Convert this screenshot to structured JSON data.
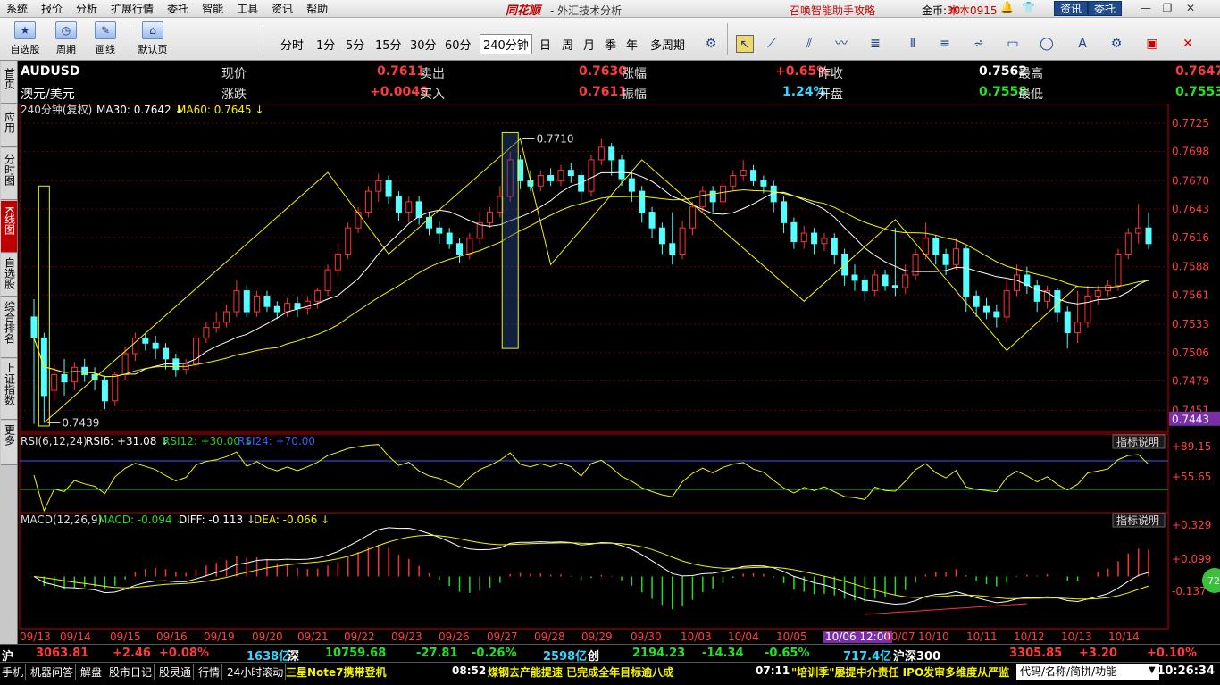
{
  "menu": {
    "items": [
      "系统",
      "报价",
      "分析",
      "扩展行情",
      "委托",
      "智能",
      "工具",
      "资讯",
      "帮助"
    ],
    "brand": "同花顺",
    "app_title": "- 外汇技术分析",
    "promo": "召唤智能助手攻略",
    "gold_label": "金币:",
    "gold_value": "30",
    "version": "本本0915",
    "news_btn": "资讯",
    "trade_btn": "委托"
  },
  "toolbar": {
    "big_buttons": [
      "自选股",
      "周期",
      "画线",
      "默认页"
    ],
    "periods": [
      "分时",
      "1分",
      "5分",
      "15分",
      "30分",
      "60分",
      "240分钟",
      "日",
      "周",
      "月",
      "季",
      "年",
      "多周期"
    ],
    "active_period": "240分钟"
  },
  "sidetabs": [
    "首页",
    "应用",
    "分时图",
    "K线图",
    "自选股",
    "综合排名",
    "上证指数",
    "更多"
  ],
  "sidetabs_active": "K线图",
  "quote": {
    "symbol": "AUDUSD",
    "name": "澳元/美元",
    "price_label": "现价",
    "price": "0.7611",
    "sell_label": "卖出",
    "sell": "0.7630",
    "chg_pct_label": "涨幅",
    "chg_pct": "+0.65%",
    "prev_close_label": "昨收",
    "prev_close": "0.7562",
    "high_label": "最高",
    "high": "0.7647",
    "chg_label": "涨跌",
    "chg": "+0.0049",
    "buy_label": "买入",
    "buy": "0.7611",
    "amp_label": "振幅",
    "amp": "1.24%",
    "open_label": "开盘",
    "open": "0.7558",
    "low_label": "最低",
    "low": "0.7553"
  },
  "main_chart": {
    "period_label": "240分钟(复权)",
    "ma30_label": "MA30: 0.7642",
    "ma60_label": "MA60: 0.7645",
    "y_ticks": [
      "0.7725",
      "0.7698",
      "0.7670",
      "0.7643",
      "0.7616",
      "0.7588",
      "0.7561",
      "0.7533",
      "0.7506",
      "0.7479",
      "0.7451"
    ],
    "current_price_tag": "0.7443",
    "high_annotation": "0.7710",
    "low_annotation": "0.7439"
  },
  "rsi": {
    "label": "RSI(6,12,24)",
    "rsi6": "RSI6: +31.08",
    "rsi12": "RSI12: +30.00",
    "rsi24": "RSI24: +70.00",
    "y_ticks": [
      "+89.15",
      "+55.65"
    ],
    "help_btn": "指标说明"
  },
  "macd": {
    "label": "MACD(12,26,9)",
    "macd_val": "MACD: -0.094",
    "diff_val": "DIFF: -0.113",
    "dea_val": "DEA: -0.066",
    "y_ticks": [
      "+0.329",
      "+0.099",
      "-0.137"
    ],
    "help_btn": "指标说明",
    "badge": "72"
  },
  "date_axis": [
    "09/13",
    "09/14",
    "09/15",
    "09/16",
    "09/19",
    "09/20",
    "09/21",
    "09/22",
    "09/23",
    "09/26",
    "09/27",
    "09/28",
    "09/29",
    "09/30",
    "10/03",
    "10/04",
    "10/05",
    "10/06 12:00",
    "10/07",
    "10/10",
    "10/11",
    "10/12",
    "10/13",
    "10/14"
  ],
  "date_axis_highlight": "10/06 12:00",
  "stockbar": {
    "sh_label": "沪",
    "sh_index": "3063.81",
    "sh_chg": "+2.46",
    "sh_pct": "+0.08%",
    "sh_amount": "1638亿",
    "sz_label": "深",
    "sz_index": "10759.68",
    "sz_chg": "-27.81",
    "sz_pct": "-0.26%",
    "sz_amount": "2598亿",
    "cy_label": "创",
    "cy_index": "2194.23",
    "cy_chg": "-14.34",
    "cy_pct": "-0.65%",
    "cy_amount": "717.4亿",
    "hs_label": "沪深300",
    "hs_index": "3305.85",
    "hs_chg": "+3.20",
    "hs_pct": "+0.10%"
  },
  "statusbar": {
    "items": [
      "手机",
      "机器问答",
      "解盘",
      "股市日记",
      "股灵通",
      "行情",
      "24小时滚动"
    ],
    "news1": "三星Note7携带登机",
    "news2_time": "08:52",
    "news2": "煤钢去产能提速  已完成全年目标逾八成",
    "news3_time": "07:11",
    "news3": "\"培训季\"屡提中介责任 IPO发审多维度从严监",
    "search_placeholder": "代码/名称/简拼/功能",
    "clock": "10:26:34"
  },
  "chart_data": {
    "type": "candlestick",
    "instrument": "AUDUSD",
    "period": "240分钟",
    "ylim": [
      0.743,
      0.773
    ],
    "y_ticks": [
      0.7725,
      0.7698,
      0.767,
      0.7643,
      0.7616,
      0.7588,
      0.7561,
      0.7533,
      0.7506,
      0.7479,
      0.7451
    ],
    "candles": [
      [
        0.754,
        0.752,
        0.7557,
        0.7438
      ],
      [
        0.752,
        0.7465,
        0.7525,
        0.744
      ],
      [
        0.747,
        0.7485,
        0.7495,
        0.746
      ],
      [
        0.7485,
        0.7478,
        0.75,
        0.7465
      ],
      [
        0.7478,
        0.7492,
        0.7497,
        0.747
      ],
      [
        0.7492,
        0.7485,
        0.75,
        0.7478
      ],
      [
        0.7485,
        0.748,
        0.7492,
        0.747
      ],
      [
        0.748,
        0.746,
        0.7484,
        0.7452
      ],
      [
        0.746,
        0.7485,
        0.7488,
        0.7455
      ],
      [
        0.7485,
        0.7505,
        0.7512,
        0.748
      ],
      [
        0.7505,
        0.752,
        0.7525,
        0.7498
      ],
      [
        0.752,
        0.7515,
        0.7525,
        0.7508
      ],
      [
        0.7515,
        0.751,
        0.7522,
        0.75
      ],
      [
        0.751,
        0.75,
        0.7515,
        0.749
      ],
      [
        0.75,
        0.749,
        0.7505,
        0.7483
      ],
      [
        0.749,
        0.7495,
        0.75,
        0.7485
      ],
      [
        0.7495,
        0.752,
        0.7525,
        0.749
      ],
      [
        0.752,
        0.753,
        0.7535,
        0.7515
      ],
      [
        0.753,
        0.7535,
        0.7545,
        0.7525
      ],
      [
        0.7535,
        0.7545,
        0.7552,
        0.753
      ],
      [
        0.7545,
        0.7565,
        0.7575,
        0.754
      ],
      [
        0.7565,
        0.7545,
        0.757,
        0.754
      ],
      [
        0.7545,
        0.756,
        0.7565,
        0.754
      ],
      [
        0.756,
        0.755,
        0.7565,
        0.7545
      ],
      [
        0.755,
        0.7545,
        0.7555,
        0.7538
      ],
      [
        0.7545,
        0.7553,
        0.7558,
        0.754
      ],
      [
        0.7553,
        0.7548,
        0.756,
        0.754
      ],
      [
        0.7548,
        0.7555,
        0.756,
        0.7542
      ],
      [
        0.7555,
        0.7565,
        0.7568,
        0.7548
      ],
      [
        0.7565,
        0.7585,
        0.759,
        0.756
      ],
      [
        0.7585,
        0.76,
        0.761,
        0.758
      ],
      [
        0.76,
        0.7625,
        0.763,
        0.7595
      ],
      [
        0.7625,
        0.764,
        0.7645,
        0.762
      ],
      [
        0.764,
        0.766,
        0.7665,
        0.7635
      ],
      [
        0.766,
        0.767,
        0.7677,
        0.765
      ],
      [
        0.767,
        0.7655,
        0.7675,
        0.7648
      ],
      [
        0.7655,
        0.764,
        0.766,
        0.7632
      ],
      [
        0.764,
        0.765,
        0.7655,
        0.763
      ],
      [
        0.765,
        0.7635,
        0.7655,
        0.7628
      ],
      [
        0.7635,
        0.7625,
        0.764,
        0.7618
      ],
      [
        0.7625,
        0.762,
        0.7632,
        0.761
      ],
      [
        0.762,
        0.761,
        0.7625,
        0.7605
      ],
      [
        0.761,
        0.76,
        0.7615,
        0.7592
      ],
      [
        0.76,
        0.7615,
        0.762,
        0.7595
      ],
      [
        0.7615,
        0.763,
        0.764,
        0.761
      ],
      [
        0.763,
        0.764,
        0.7645,
        0.7625
      ],
      [
        0.764,
        0.7655,
        0.7665,
        0.7635
      ],
      [
        0.7655,
        0.769,
        0.7698,
        0.765
      ],
      [
        0.769,
        0.767,
        0.7695,
        0.7662
      ],
      [
        0.767,
        0.7665,
        0.768,
        0.766
      ],
      [
        0.7665,
        0.7675,
        0.768,
        0.766
      ],
      [
        0.7675,
        0.767,
        0.7682,
        0.7665
      ],
      [
        0.767,
        0.768,
        0.7685,
        0.7665
      ],
      [
        0.768,
        0.7675,
        0.7687,
        0.7668
      ],
      [
        0.7675,
        0.766,
        0.768,
        0.765
      ],
      [
        0.766,
        0.769,
        0.7695,
        0.7655
      ],
      [
        0.769,
        0.7702,
        0.771,
        0.7685
      ],
      [
        0.7702,
        0.769,
        0.7706,
        0.7675
      ],
      [
        0.769,
        0.7672,
        0.7695,
        0.7665
      ],
      [
        0.7672,
        0.766,
        0.768,
        0.765
      ],
      [
        0.766,
        0.764,
        0.7665,
        0.763
      ],
      [
        0.764,
        0.7625,
        0.7645,
        0.7615
      ],
      [
        0.7625,
        0.761,
        0.763,
        0.76
      ],
      [
        0.761,
        0.76,
        0.764,
        0.759
      ],
      [
        0.76,
        0.7625,
        0.7632,
        0.7595
      ],
      [
        0.7625,
        0.7645,
        0.765,
        0.7618
      ],
      [
        0.7645,
        0.766,
        0.7665,
        0.764
      ],
      [
        0.766,
        0.765,
        0.7665,
        0.764
      ],
      [
        0.765,
        0.7665,
        0.767,
        0.7645
      ],
      [
        0.7665,
        0.7675,
        0.768,
        0.766
      ],
      [
        0.7675,
        0.768,
        0.769,
        0.767
      ],
      [
        0.768,
        0.767,
        0.7685,
        0.7665
      ],
      [
        0.767,
        0.7665,
        0.7675,
        0.7658
      ],
      [
        0.7665,
        0.765,
        0.767,
        0.764
      ],
      [
        0.765,
        0.763,
        0.7655,
        0.762
      ],
      [
        0.763,
        0.7612,
        0.7635,
        0.7605
      ],
      [
        0.7612,
        0.762,
        0.7627,
        0.7605
      ],
      [
        0.762,
        0.761,
        0.7625,
        0.76
      ],
      [
        0.761,
        0.7615,
        0.762,
        0.7603
      ],
      [
        0.7615,
        0.76,
        0.762,
        0.759
      ],
      [
        0.76,
        0.758,
        0.7605,
        0.757
      ],
      [
        0.758,
        0.7575,
        0.759,
        0.7565
      ],
      [
        0.7575,
        0.7565,
        0.758,
        0.7555
      ],
      [
        0.7565,
        0.758,
        0.7585,
        0.756
      ],
      [
        0.758,
        0.757,
        0.7585,
        0.7565
      ],
      [
        0.757,
        0.7568,
        0.7625,
        0.756
      ],
      [
        0.7568,
        0.758,
        0.759,
        0.7562
      ],
      [
        0.758,
        0.76,
        0.7605,
        0.7575
      ],
      [
        0.76,
        0.7615,
        0.763,
        0.7595
      ],
      [
        0.7615,
        0.76,
        0.7618,
        0.759
      ],
      [
        0.76,
        0.759,
        0.7605,
        0.758
      ],
      [
        0.759,
        0.7605,
        0.7615,
        0.7585
      ],
      [
        0.7605,
        0.756,
        0.7608,
        0.7545
      ],
      [
        0.756,
        0.755,
        0.7565,
        0.754
      ],
      [
        0.755,
        0.7545,
        0.7558,
        0.7538
      ],
      [
        0.7545,
        0.754,
        0.7552,
        0.753
      ],
      [
        0.754,
        0.7565,
        0.7575,
        0.7535
      ],
      [
        0.7565,
        0.758,
        0.759,
        0.756
      ],
      [
        0.758,
        0.757,
        0.7588,
        0.7562
      ],
      [
        0.757,
        0.7555,
        0.7575,
        0.7545
      ],
      [
        0.7555,
        0.7565,
        0.757,
        0.7548
      ],
      [
        0.7565,
        0.7545,
        0.7568,
        0.7535
      ],
      [
        0.7545,
        0.7525,
        0.755,
        0.751
      ],
      [
        0.7525,
        0.7535,
        0.7565,
        0.7515
      ],
      [
        0.7535,
        0.756,
        0.757,
        0.753
      ],
      [
        0.756,
        0.7565,
        0.757,
        0.7552
      ],
      [
        0.7565,
        0.757,
        0.7575,
        0.756
      ],
      [
        0.757,
        0.76,
        0.7605,
        0.7565
      ],
      [
        0.76,
        0.762,
        0.7625,
        0.7595
      ],
      [
        0.762,
        0.7625,
        0.7648,
        0.761
      ],
      [
        0.7625,
        0.761,
        0.764,
        0.7605
      ]
    ],
    "ma30_label": "MA30",
    "ma60_label": "MA60",
    "high_marker": 0.771,
    "low_marker": 0.7439
  }
}
